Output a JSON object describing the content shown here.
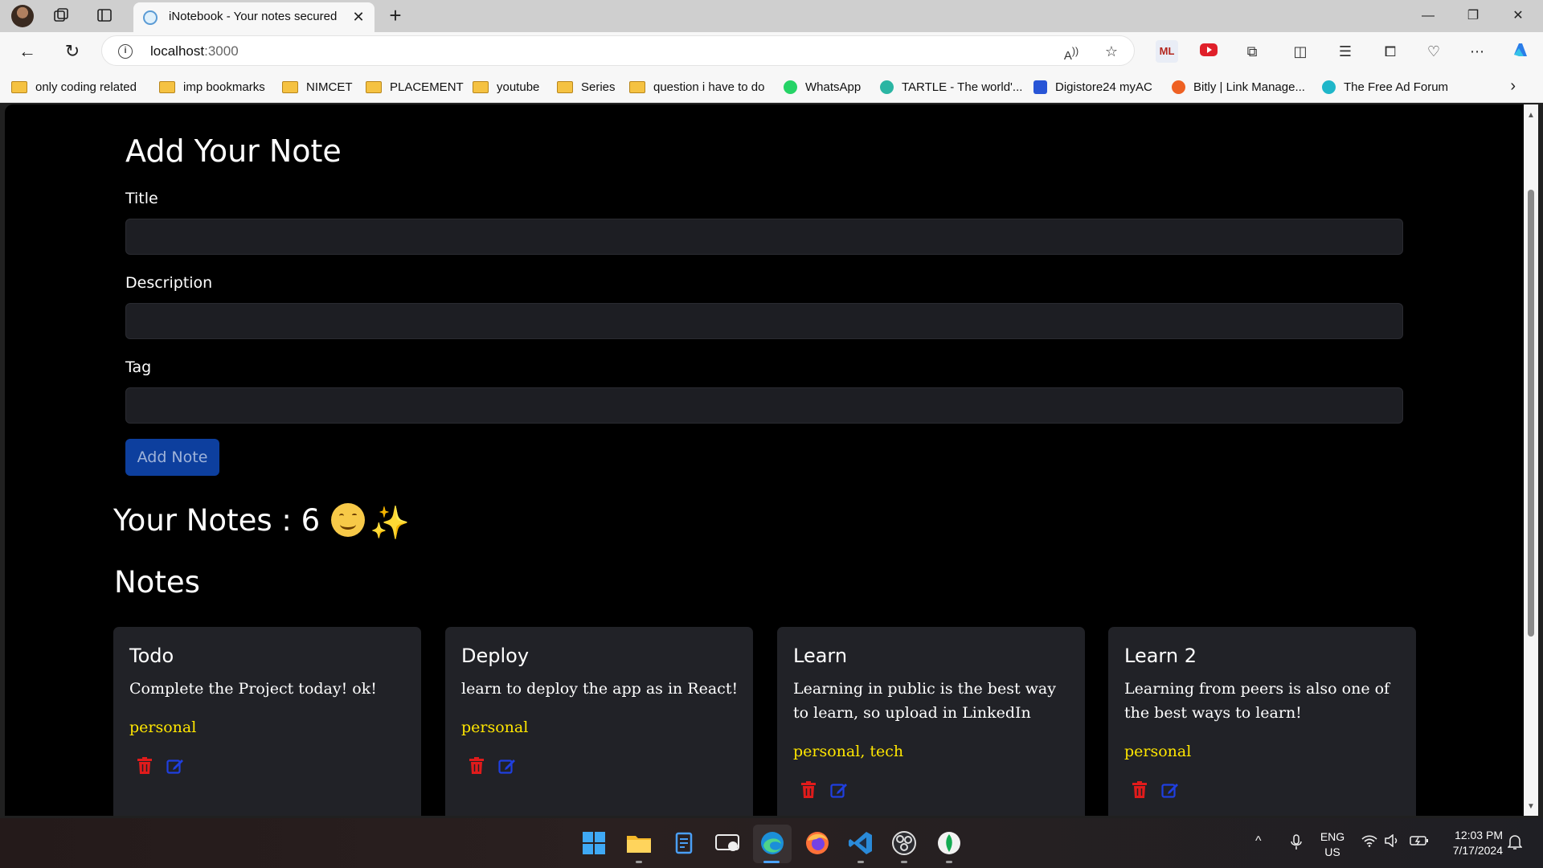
{
  "browser": {
    "tab_title": "iNotebook - Your notes secured",
    "url_host": "localhost",
    "url_port": ":3000",
    "bookmarks": [
      {
        "label": "only coding  related",
        "type": "folder"
      },
      {
        "label": "imp bookmarks",
        "type": "folder"
      },
      {
        "label": "NIMCET",
        "type": "folder"
      },
      {
        "label": "PLACEMENT",
        "type": "folder"
      },
      {
        "label": "youtube",
        "type": "folder"
      },
      {
        "label": "Series",
        "type": "folder"
      },
      {
        "label": "question i have to do",
        "type": "folder"
      },
      {
        "label": "WhatsApp",
        "type": "site",
        "color": "#25d366"
      },
      {
        "label": "TARTLE - The world'...",
        "type": "site",
        "color": "#2bb5a3"
      },
      {
        "label": "Digistore24 myAC",
        "type": "site",
        "color": "#2855d6"
      },
      {
        "label": "Bitly | Link Manage...",
        "type": "site",
        "color": "#ee6123"
      },
      {
        "label": "The Free Ad Forum",
        "type": "site",
        "color": "#1fb6c9"
      }
    ]
  },
  "form": {
    "heading": "Add Your Note",
    "title_label": "Title",
    "title_value": "",
    "description_label": "Description",
    "description_value": "",
    "tag_label": "Tag",
    "tag_value": "",
    "add_button": "Add Note",
    "button_color": "#0d3f9e"
  },
  "notes_summary": {
    "count_text": "Your Notes : 6",
    "sparkle": "✨"
  },
  "notes_heading": "Notes",
  "notes": [
    {
      "title": "Todo",
      "description": "Complete the Project today! ok!",
      "tag": "personal"
    },
    {
      "title": "Deploy",
      "description": "learn to deploy the app as in React!",
      "tag": "personal"
    },
    {
      "title": "Learn",
      "description": "Learning in public is the best way to learn, so upload in LinkedIn",
      "tag": "personal, tech"
    },
    {
      "title": "Learn 2",
      "description": "Learning from peers is also one of the best ways to learn!",
      "tag": "personal"
    }
  ],
  "colors": {
    "tag": "#ffe600",
    "delete_icon": "#e01b1b",
    "edit_icon": "#1f3fe0",
    "card_bg": "#212227",
    "page_bg": "#000000"
  },
  "taskbar": {
    "language": "ENG",
    "region": "US",
    "time": "12:03 PM",
    "date": "7/17/2024"
  }
}
